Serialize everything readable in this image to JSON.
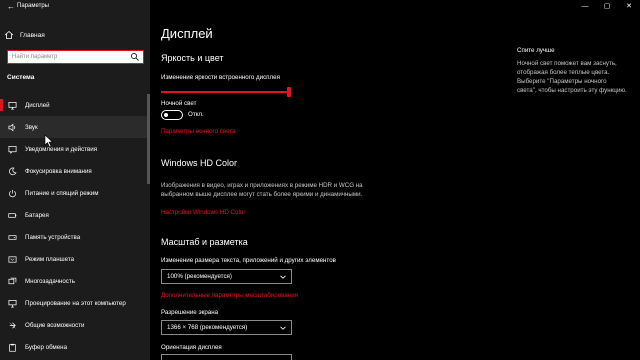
{
  "window": {
    "title": "Параметры",
    "minimize": "—",
    "maximize": "▢",
    "close": "✕"
  },
  "sidebar": {
    "home_label": "Главная",
    "search_placeholder": "Найти параметр",
    "section": "Система",
    "items": [
      {
        "label": "Дисплей",
        "icon": "monitor-icon",
        "active": true
      },
      {
        "label": "Звук",
        "icon": "speaker-icon",
        "hover": true
      },
      {
        "label": "Уведомления и действия",
        "icon": "notification-icon"
      },
      {
        "label": "Фокусировка внимания",
        "icon": "moon-icon"
      },
      {
        "label": "Питание и спящий режим",
        "icon": "power-icon"
      },
      {
        "label": "Батарея",
        "icon": "battery-icon"
      },
      {
        "label": "Память устройства",
        "icon": "storage-icon"
      },
      {
        "label": "Режим планшета",
        "icon": "tablet-icon"
      },
      {
        "label": "Многозадачность",
        "icon": "multitask-icon"
      },
      {
        "label": "Проецирование на этот компьютер",
        "icon": "project-icon"
      },
      {
        "label": "Общие возможности",
        "icon": "shared-icon"
      },
      {
        "label": "Буфер обмена",
        "icon": "clipboard-icon"
      }
    ]
  },
  "main": {
    "title": "Дисплей",
    "brightness": {
      "heading": "Яркость и цвет",
      "slider_label": "Изменение яркости встроенного дисплея",
      "slider_value": 1.0,
      "night_light_label": "Ночной свет",
      "toggle_state": "Откл.",
      "night_light_link": "Параметры ночного света"
    },
    "hd": {
      "heading": "Windows HD Color",
      "description": "Изображения в видео, играх и приложениях в режиме HDR и WCG на выбранном выше дисплее могут стать более яркими и динамичными.",
      "link": "Настройки Windows HD Color"
    },
    "scale": {
      "heading": "Масштаб и разметка",
      "scale_label": "Изменение размера текста, приложений и других элементов",
      "scale_value": "100% (рекомендуется)",
      "advanced_link": "Дополнительные параметры масштабирования",
      "resolution_label": "Разрешение экрана",
      "resolution_value": "1366 × 768 (рекомендуется)",
      "orientation_label": "Ориентация дисплея"
    },
    "tip": {
      "title": "Спите лучше",
      "body": "Ночной свет поможет вам заснуть, отображая более теплые цвета. Выберите \"Параметры ночного света\", чтобы настроить эту функцию."
    }
  },
  "colors": {
    "accent": "#e81123",
    "sidebar_bg": "#1c1c1c",
    "main_bg": "#000000"
  }
}
